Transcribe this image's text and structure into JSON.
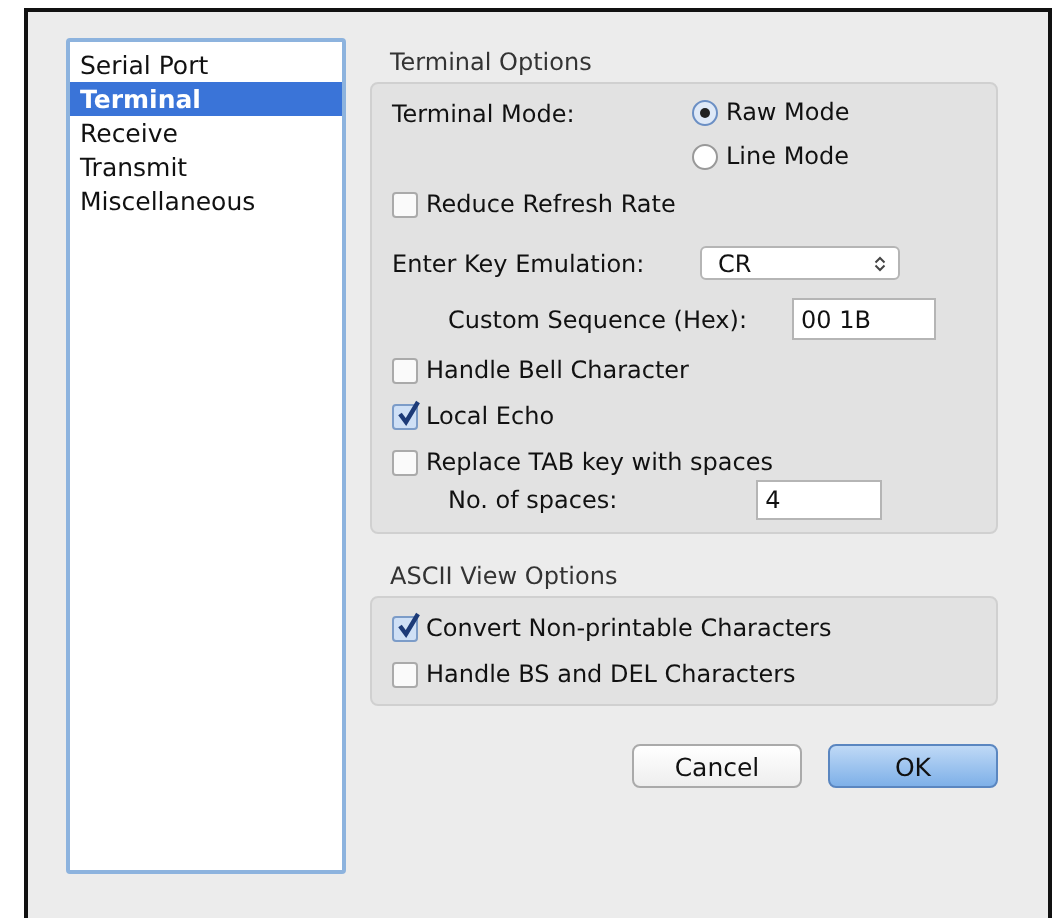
{
  "sidebar": {
    "items": [
      {
        "label": "Serial Port",
        "selected": false
      },
      {
        "label": "Terminal",
        "selected": true
      },
      {
        "label": "Receive",
        "selected": false
      },
      {
        "label": "Transmit",
        "selected": false
      },
      {
        "label": "Miscellaneous",
        "selected": false
      }
    ]
  },
  "terminal_options": {
    "title": "Terminal Options",
    "terminal_mode": {
      "label": "Terminal Mode:",
      "options": [
        {
          "label": "Raw Mode",
          "selected": true
        },
        {
          "label": "Line Mode",
          "selected": false
        }
      ]
    },
    "reduce_refresh_rate": {
      "label": "Reduce Refresh Rate",
      "checked": false
    },
    "enter_key_emulation": {
      "label": "Enter Key Emulation:",
      "value": "CR"
    },
    "custom_sequence": {
      "label": "Custom Sequence (Hex):",
      "value": "00 1B"
    },
    "handle_bell": {
      "label": "Handle Bell Character",
      "checked": false
    },
    "local_echo": {
      "label": "Local Echo",
      "checked": true
    },
    "replace_tab": {
      "label": "Replace TAB key with spaces",
      "checked": false
    },
    "no_of_spaces": {
      "label": "No. of spaces:",
      "value": "4"
    }
  },
  "ascii_view_options": {
    "title": "ASCII View Options",
    "checkboxes": [
      {
        "label": "Convert Non-printable Characters",
        "checked": true
      },
      {
        "label": "Handle BS and DEL Characters",
        "checked": false
      }
    ]
  },
  "buttons": [
    {
      "label": "Cancel",
      "kind": "normal"
    },
    {
      "label": "OK",
      "kind": "default"
    }
  ]
}
